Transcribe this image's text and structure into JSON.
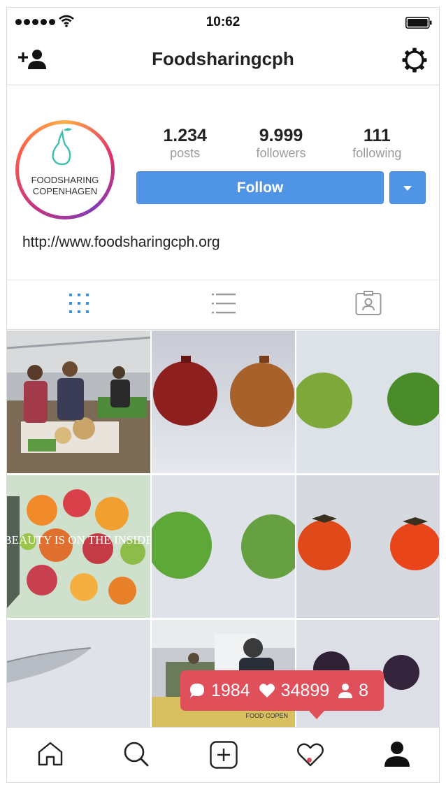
{
  "status_bar": {
    "time": "10:62"
  },
  "nav": {
    "title": "Foodsharingcph"
  },
  "profile": {
    "avatar_line1": "FOODSHARING",
    "avatar_line2": "COPENHAGEN",
    "posts_count": "1.234",
    "posts_label": "posts",
    "followers_count": "9.999",
    "followers_label": "followers",
    "following_count": "111",
    "following_label": "following",
    "follow_label": "Follow",
    "website": "http://www.foodsharingcph.org"
  },
  "grid": {
    "overlay_text": "BEAUTY IS ON THE INSIDE",
    "crop_label": "FOOD COPEN"
  },
  "notification": {
    "comments": "1984",
    "likes": "34899",
    "follows": "8"
  },
  "colors": {
    "accent": "#5095e5",
    "notification": "#e0505b",
    "ring_start": "#c13584",
    "ring_end": "#fcaf45"
  }
}
